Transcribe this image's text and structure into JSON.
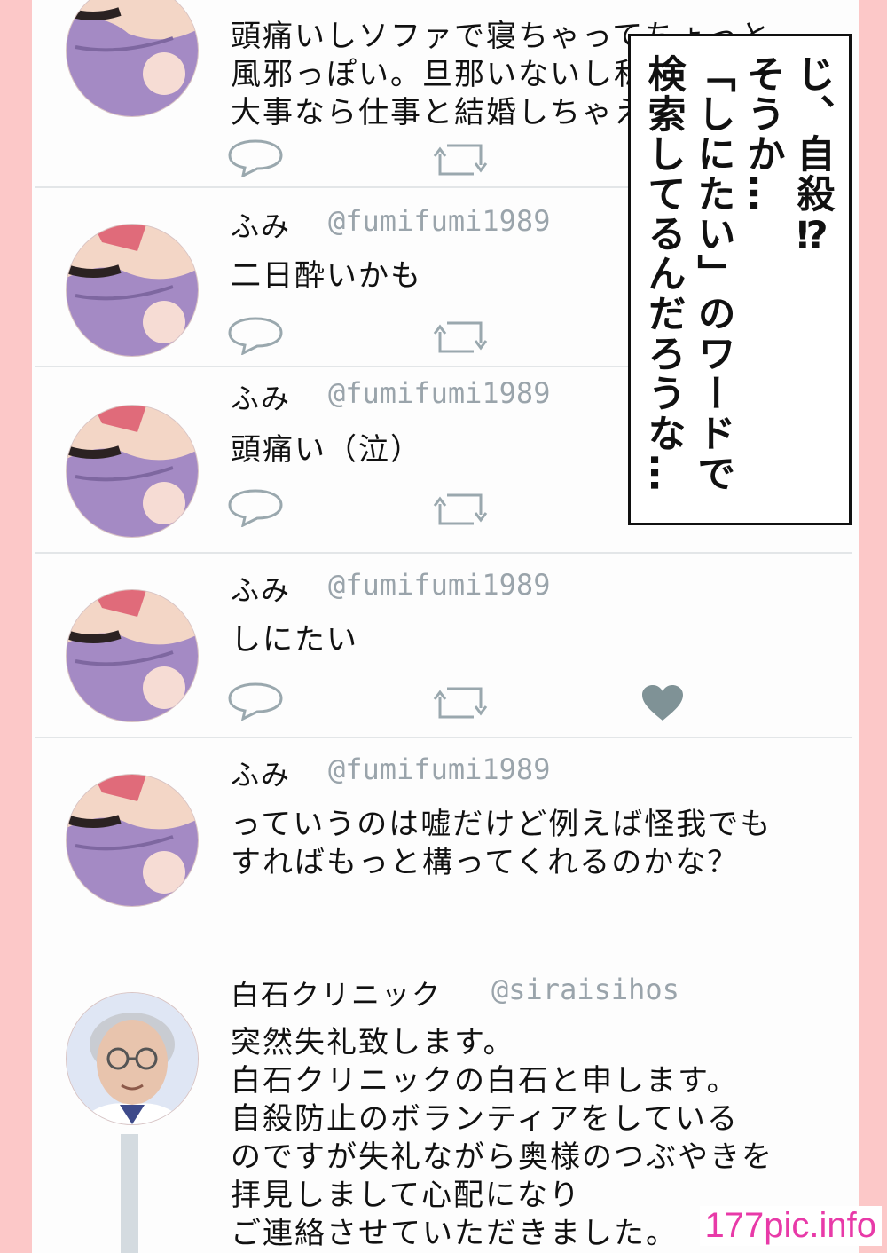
{
  "tweets": [
    {
      "name": "",
      "handle": "",
      "text": "頭痛いしソファで寝ちゃってちょっと\n風邪っぽい。旦那いないし私より仕事た\n大事なら仕事と結婚しちゃえばいいのに！",
      "liked": false
    },
    {
      "name": "ふみ",
      "handle": "@fumifumi1989",
      "text": "二日酔いかも",
      "liked": false
    },
    {
      "name": "ふみ",
      "handle": "@fumifumi1989",
      "text": "頭痛い（泣）",
      "liked": false
    },
    {
      "name": "ふみ",
      "handle": "@fumifumi1989",
      "text": "しにたい",
      "liked": true
    },
    {
      "name": "ふみ",
      "handle": "@fumifumi1989",
      "text": "っていうのは嘘だけど例えば怪我でも\nすればもっと構ってくれるのかな？",
      "liked": false
    },
    {
      "name": "白石クリニック",
      "handle": "@siraisihos",
      "text": "突然失礼致します。\n白石クリニックの白石と申します。\n自殺防止のボランティアをしている\nのですが失礼ながら奥様のつぶやきを\n拝見しまして心配になり\nご連絡させていただきました。"
    }
  ],
  "caption": {
    "col1": "じ、自殺⁉",
    "col2": "そうか…",
    "col3": "「しにたい」のワードで",
    "col4": "検索してるんだろうな…"
  },
  "watermark": "177pic.info",
  "colors": {
    "background": "#fcc8c8",
    "icon": "#9aa8ae",
    "heart_liked": "#7f9296",
    "watermark": "#e83aa8"
  }
}
